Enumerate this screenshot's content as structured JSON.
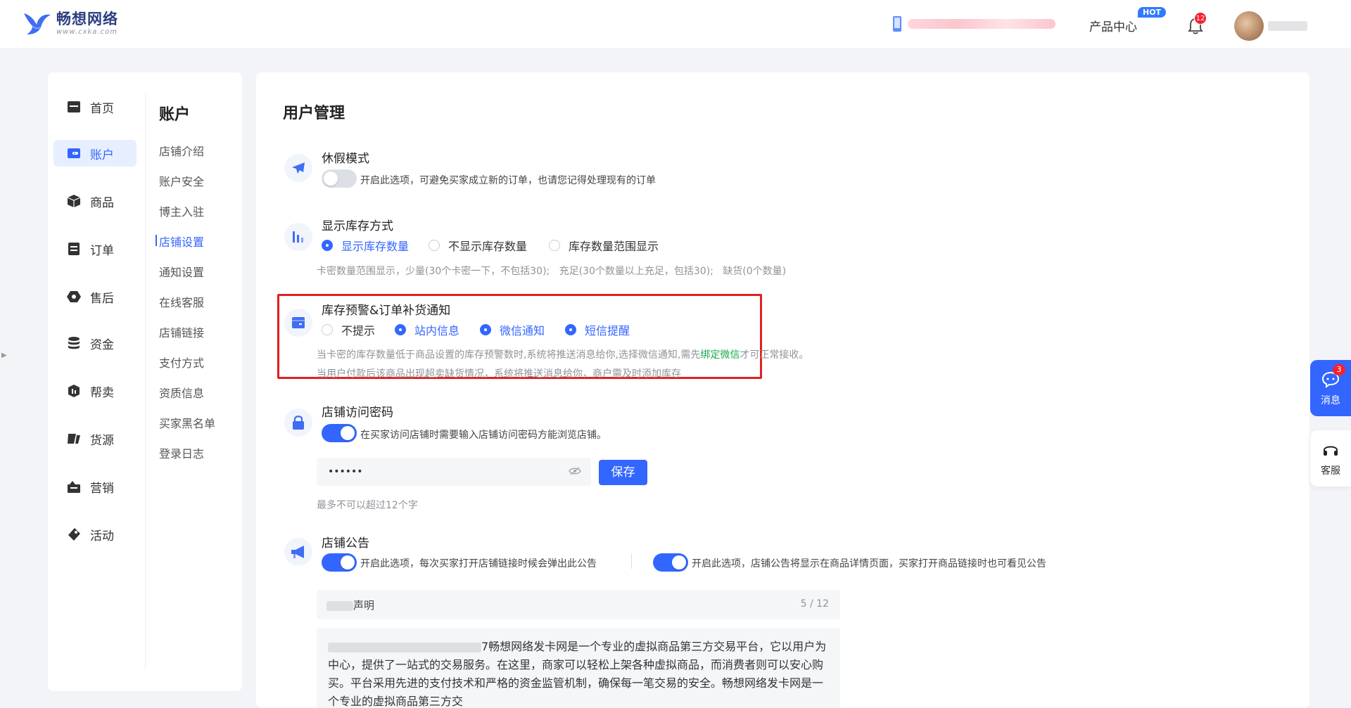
{
  "header": {
    "brand_name": "畅想网络",
    "brand_url": "www.cxka.com",
    "product_center": "产品中心",
    "hot_badge": "HOT",
    "notification_count": "12"
  },
  "sidebar": {
    "items": [
      {
        "label": "首页",
        "icon": "store-icon"
      },
      {
        "label": "账户",
        "icon": "wallet-icon"
      },
      {
        "label": "商品",
        "icon": "box-icon"
      },
      {
        "label": "订单",
        "icon": "order-icon"
      },
      {
        "label": "售后",
        "icon": "aftersale-icon"
      },
      {
        "label": "资金",
        "icon": "coins-icon"
      },
      {
        "label": "帮卖",
        "icon": "helpsell-icon"
      },
      {
        "label": "货源",
        "icon": "supply-icon"
      },
      {
        "label": "营销",
        "icon": "marketing-icon"
      },
      {
        "label": "活动",
        "icon": "activity-icon"
      }
    ],
    "active": "账户"
  },
  "submenu": {
    "title": "账户",
    "items": [
      "店铺介绍",
      "账户安全",
      "博主入驻",
      "店铺设置",
      "通知设置",
      "在线客服",
      "店铺链接",
      "支付方式",
      "资质信息",
      "买家黑名单",
      "登录日志"
    ],
    "active": "店铺设置"
  },
  "main": {
    "title": "用户管理",
    "vacation": {
      "title": "休假模式",
      "desc": "开启此选项，可避免买家成立新的订单，也请您记得处理现有的订单",
      "enabled": false
    },
    "stock_display": {
      "title": "显示库存方式",
      "options": [
        "显示库存数量",
        "不显示库存数量",
        "库存数量范围显示"
      ],
      "selected": "显示库存数量",
      "hint": "卡密数量范围显示，少量(30个卡密一下，不包括30);   充足(30个数量以上充足，包括30);   缺货(0个数量)"
    },
    "stock_alert": {
      "title": "库存预警&订单补货通知",
      "options": [
        "不提示",
        "站内信息",
        "微信通知",
        "短信提醒"
      ],
      "selected": [
        "站内信息",
        "微信通知",
        "短信提醒"
      ],
      "hint1_before": "当卡密的库存数量低于商品设置的库存预警数时,系统将推送消息给你,选择微信通知,需先",
      "hint1_link": "绑定微信",
      "hint1_after": "才可正常接收。",
      "hint2": "当用户付款后该商品出现超卖缺货情况，系统将推送消息给你，商户需及时添加库存"
    },
    "shop_password": {
      "title": "店铺访问密码",
      "desc": "在买家访问店铺时需要输入店铺访问密码方能浏览店铺。",
      "enabled": true,
      "password_value": "••••••",
      "save_label": "保存",
      "hint": "最多不可以超过12个字"
    },
    "announcement": {
      "title": "店铺公告",
      "toggle1_desc": "开启此选项，每次买家打开店铺链接时候会弹出此公告",
      "toggle2_desc": "开启此选项，店铺公告将显示在商品详情页面，买家打开商品链接时也可看见公告",
      "title_field_suffix": "声明",
      "title_count": "5 / 12",
      "body_line1": "7畅想网络发卡网是一个专业的虚拟商品第三方交易平台，它以用",
      "body_rest": "户为中心，提供了一站式的交易服务。在这里，商家可以轻松上架各种虚拟商品，而消费者则可以安心购买。平台采用先进的支付技术和严格的资金监管机制，确保每一笔交易的安全。畅想网络发卡网是一个专业的虚拟商品第三方交"
    }
  },
  "float": {
    "message_label": "消息",
    "message_count": "3",
    "service_label": "客服"
  },
  "colors": {
    "primary": "#3366ff",
    "highlight_box": "#e02020",
    "link_green": "#19a84a"
  }
}
